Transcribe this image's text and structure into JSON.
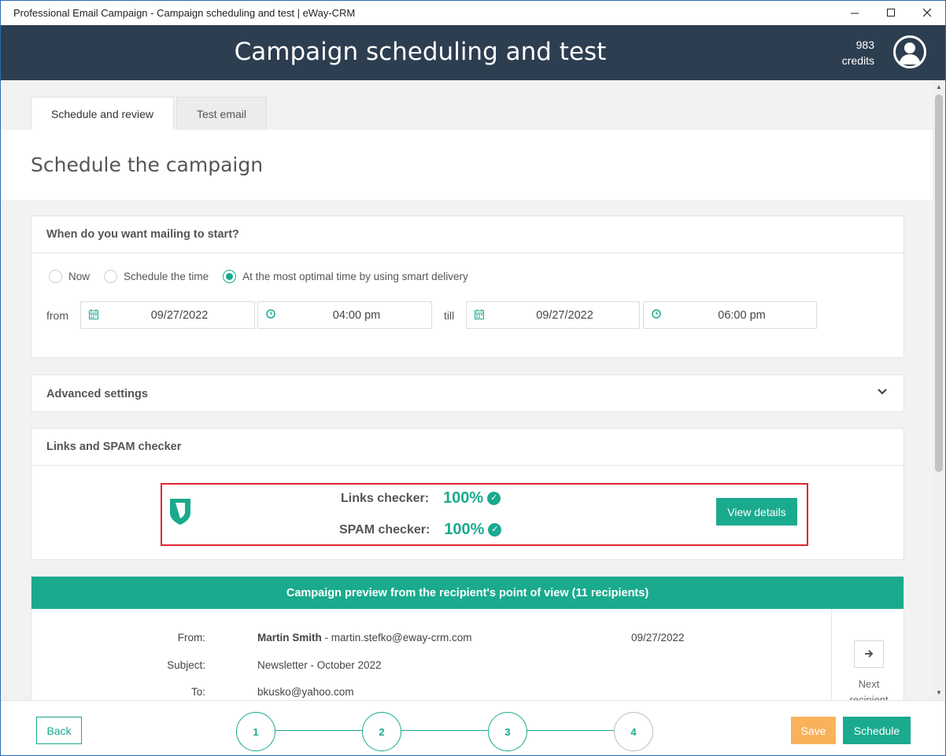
{
  "window": {
    "title": "Professional Email Campaign - Campaign scheduling and test | eWay-CRM",
    "minimize": "—",
    "maximize": "☐",
    "close": "✕"
  },
  "header": {
    "title": "Campaign scheduling and test",
    "credits_count": "983",
    "credits_label": "credits"
  },
  "tabs": [
    {
      "label": "Schedule and review",
      "active": true
    },
    {
      "label": "Test email",
      "active": false
    }
  ],
  "page": {
    "title": "Schedule the campaign"
  },
  "schedule": {
    "heading": "When do you want mailing to start?",
    "options": [
      {
        "label": "Now",
        "selected": false
      },
      {
        "label": "Schedule the time",
        "selected": false
      },
      {
        "label": "At the most optimal time by using smart delivery",
        "selected": true
      }
    ],
    "from_label": "from",
    "till_label": "till",
    "from_date": "09/27/2022",
    "from_time": "04:00 pm",
    "till_date": "09/27/2022",
    "till_time": "06:00 pm"
  },
  "advanced": {
    "heading": "Advanced settings"
  },
  "checker": {
    "heading": "Links and SPAM checker",
    "links_label": "Links checker:",
    "links_value": "100%",
    "spam_label": "SPAM checker:",
    "spam_value": "100%",
    "view_details": "View details"
  },
  "preview": {
    "heading": "Campaign preview from the recipient's point of view (11 recipients)",
    "from_label": "From:",
    "from_name": "Martin Smith",
    "from_email": " - martin.stefko@eway-crm.com",
    "date": "09/27/2022",
    "subject_label": "Subject:",
    "subject": "Newsletter - October 2022",
    "to_label": "To:",
    "to": "bkusko@yahoo.com",
    "next_label_1": "Next",
    "next_label_2": "recipient"
  },
  "footer": {
    "back": "Back",
    "steps": [
      "1",
      "2",
      "3",
      "4"
    ],
    "save": "Save",
    "schedule": "Schedule"
  },
  "colors": {
    "accent": "#1aaa8e",
    "header_bg": "#2c3e50",
    "save": "#f9b25a",
    "highlight_border": "#e0262f"
  }
}
